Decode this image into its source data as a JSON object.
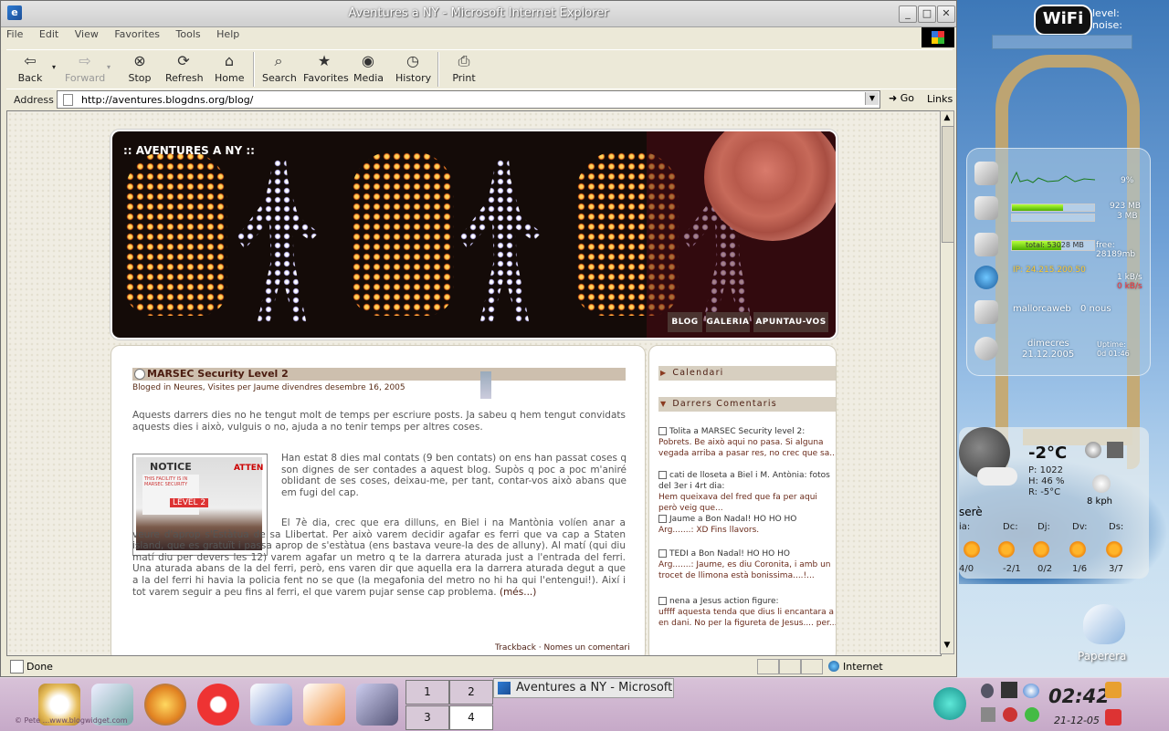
{
  "window": {
    "title": "Aventures a NY - Microsoft Internet Explorer",
    "menu": [
      "File",
      "Edit",
      "View",
      "Favorites",
      "Tools",
      "Help"
    ],
    "toolbar": {
      "back": "Back",
      "forward": "Forward",
      "stop": "Stop",
      "refresh": "Refresh",
      "home": "Home",
      "search": "Search",
      "favorites": "Favorites",
      "media": "Media",
      "history": "History",
      "print": "Print"
    },
    "address_label": "Address",
    "url": "http://aventures.blogdns.org/blog/",
    "go": "Go",
    "links": "Links",
    "status": "Done",
    "zone": "Internet"
  },
  "page": {
    "banner_title": ":: AVENTURES A NY ::",
    "nav": [
      "BLOG",
      "GALERIA",
      "APUNTAU-VOS"
    ],
    "post": {
      "title": "MARSEC Security Level 2",
      "meta": "Bloged in Neures, Visites per Jaume divendres desembre 16, 2005",
      "p1": "Aquests darrers dies no he tengut molt de temps per escriure posts. Ja sabeu q hem tengut convidats aquests dies i això, vulguis o no, ajuda a no tenir temps per altres coses.",
      "p2": "Han estat 8 dies mal contats (9 ben contats) on ens han passat coses q son dignes de ser contades a aquest blog. Supòs q poc a poc m'aniré oblidant de ses coses, deixau-me, per tant, contar-vos això abans que em fugi del cap.",
      "p3": "El 7è dia, crec que era dilluns, en Biel i na Mantònia volíen anar a veure d'aprop s'Estàtua de sa Llibertat. Per això varem decidir agafar es ferri que va cap a Staten island, que es gratuït i passa aprop de s'estàtua (ens bastava veure-la des de alluny). Al matí (qui diu matí diu per devers les 12) varem agafar un metro q te la darrera aturada just a l'entrada del ferri. Una aturada abans de la del ferri, però, ens varen dir que aquella era la darrera aturada degut a que a la del ferri hi havia la policia fent no se que (la megafonia del metro no hi ha qui l'entengui!). Així i tot varem seguir a peu fins al ferri, el que varem pujar sense cap problema.",
      "more": "(més...)",
      "image_text": {
        "notice": "NOTICE",
        "line1": "THIS FACILITY IS IN",
        "line2": "MARSEC SECURITY",
        "level": "LEVEL 2",
        "attention": "ATTEN"
      },
      "footer": "Trackback · Nomes un comentari"
    },
    "sidebar": {
      "calendar": "Calendari",
      "recent": "Darrers Comentaris",
      "comments": [
        {
          "head": "Tolita a MARSEC Security level 2:",
          "body": "Pobrets. Be això aqui no pasa. Si alguna vegada arriba a pasar res, no crec que sa..."
        },
        {
          "head": "cati de lloseta a Biel i M. Antònia: fotos del 3er i 4rt dia:",
          "body": "Hem queixava del fred que fa per aqui però veig que..."
        },
        {
          "head": "Jaume a Bon Nadal! HO HO HO",
          "body": "Arg.......: XD Fins llavors."
        },
        {
          "head": "TEDI a Bon Nadal! HO HO HO",
          "body": "Arg.......: Jaume, es diu Coronita, i amb un trocet de llimona està bonissima....!..."
        },
        {
          "head": "nena a Jesus action figure:",
          "body": "uffff aquesta tenda que dius li encantara a en dani. No per la figureta de Jesus.... per..."
        }
      ]
    }
  },
  "widgets": {
    "wifi": {
      "logo": "WiFi",
      "level": "level:",
      "noise": "noise:"
    },
    "sysmon": {
      "cpu": "9%",
      "mem1": "923 MB",
      "mem2": "3 MB",
      "disk_total": "total: 53028 MB",
      "disk_free": "free: 28189mb",
      "ip": "IP: 24.215.200.50",
      "net_up": "1 kB/s",
      "net_down": "0 kB/s",
      "mail_account": "mallorcaweb",
      "mail_new": "0 nous",
      "day": "dimecres",
      "date": "21.12.2005",
      "uptime_label": "Uptime:",
      "uptime": "0d 01:46"
    },
    "sysmon_levels": {
      "cpu": 0.09,
      "mem": 0.62,
      "disk": 0.6
    },
    "weather": {
      "temp": "-2°C",
      "pressure": "P: 1022",
      "humidity": "H: 46 %",
      "real": "R: -5°C",
      "wind": "8 kph",
      "location": "serè",
      "days": [
        {
          "d": "ia:",
          "r": "4/0"
        },
        {
          "d": "Dc:",
          "r": "-2/1"
        },
        {
          "d": "Dj:",
          "r": "0/2"
        },
        {
          "d": "Dv:",
          "r": "1/6"
        },
        {
          "d": "Ds:",
          "r": "3/7"
        }
      ]
    },
    "trash": "Paperera"
  },
  "taskbar": {
    "desktops": [
      "1",
      "2",
      "3",
      "4"
    ],
    "active_desktop": "4",
    "task": "Aventures a NY - Microsoft",
    "time": "02:42",
    "date": "21-12-05",
    "credit": "© Pete ...www.blogwidget.com"
  }
}
